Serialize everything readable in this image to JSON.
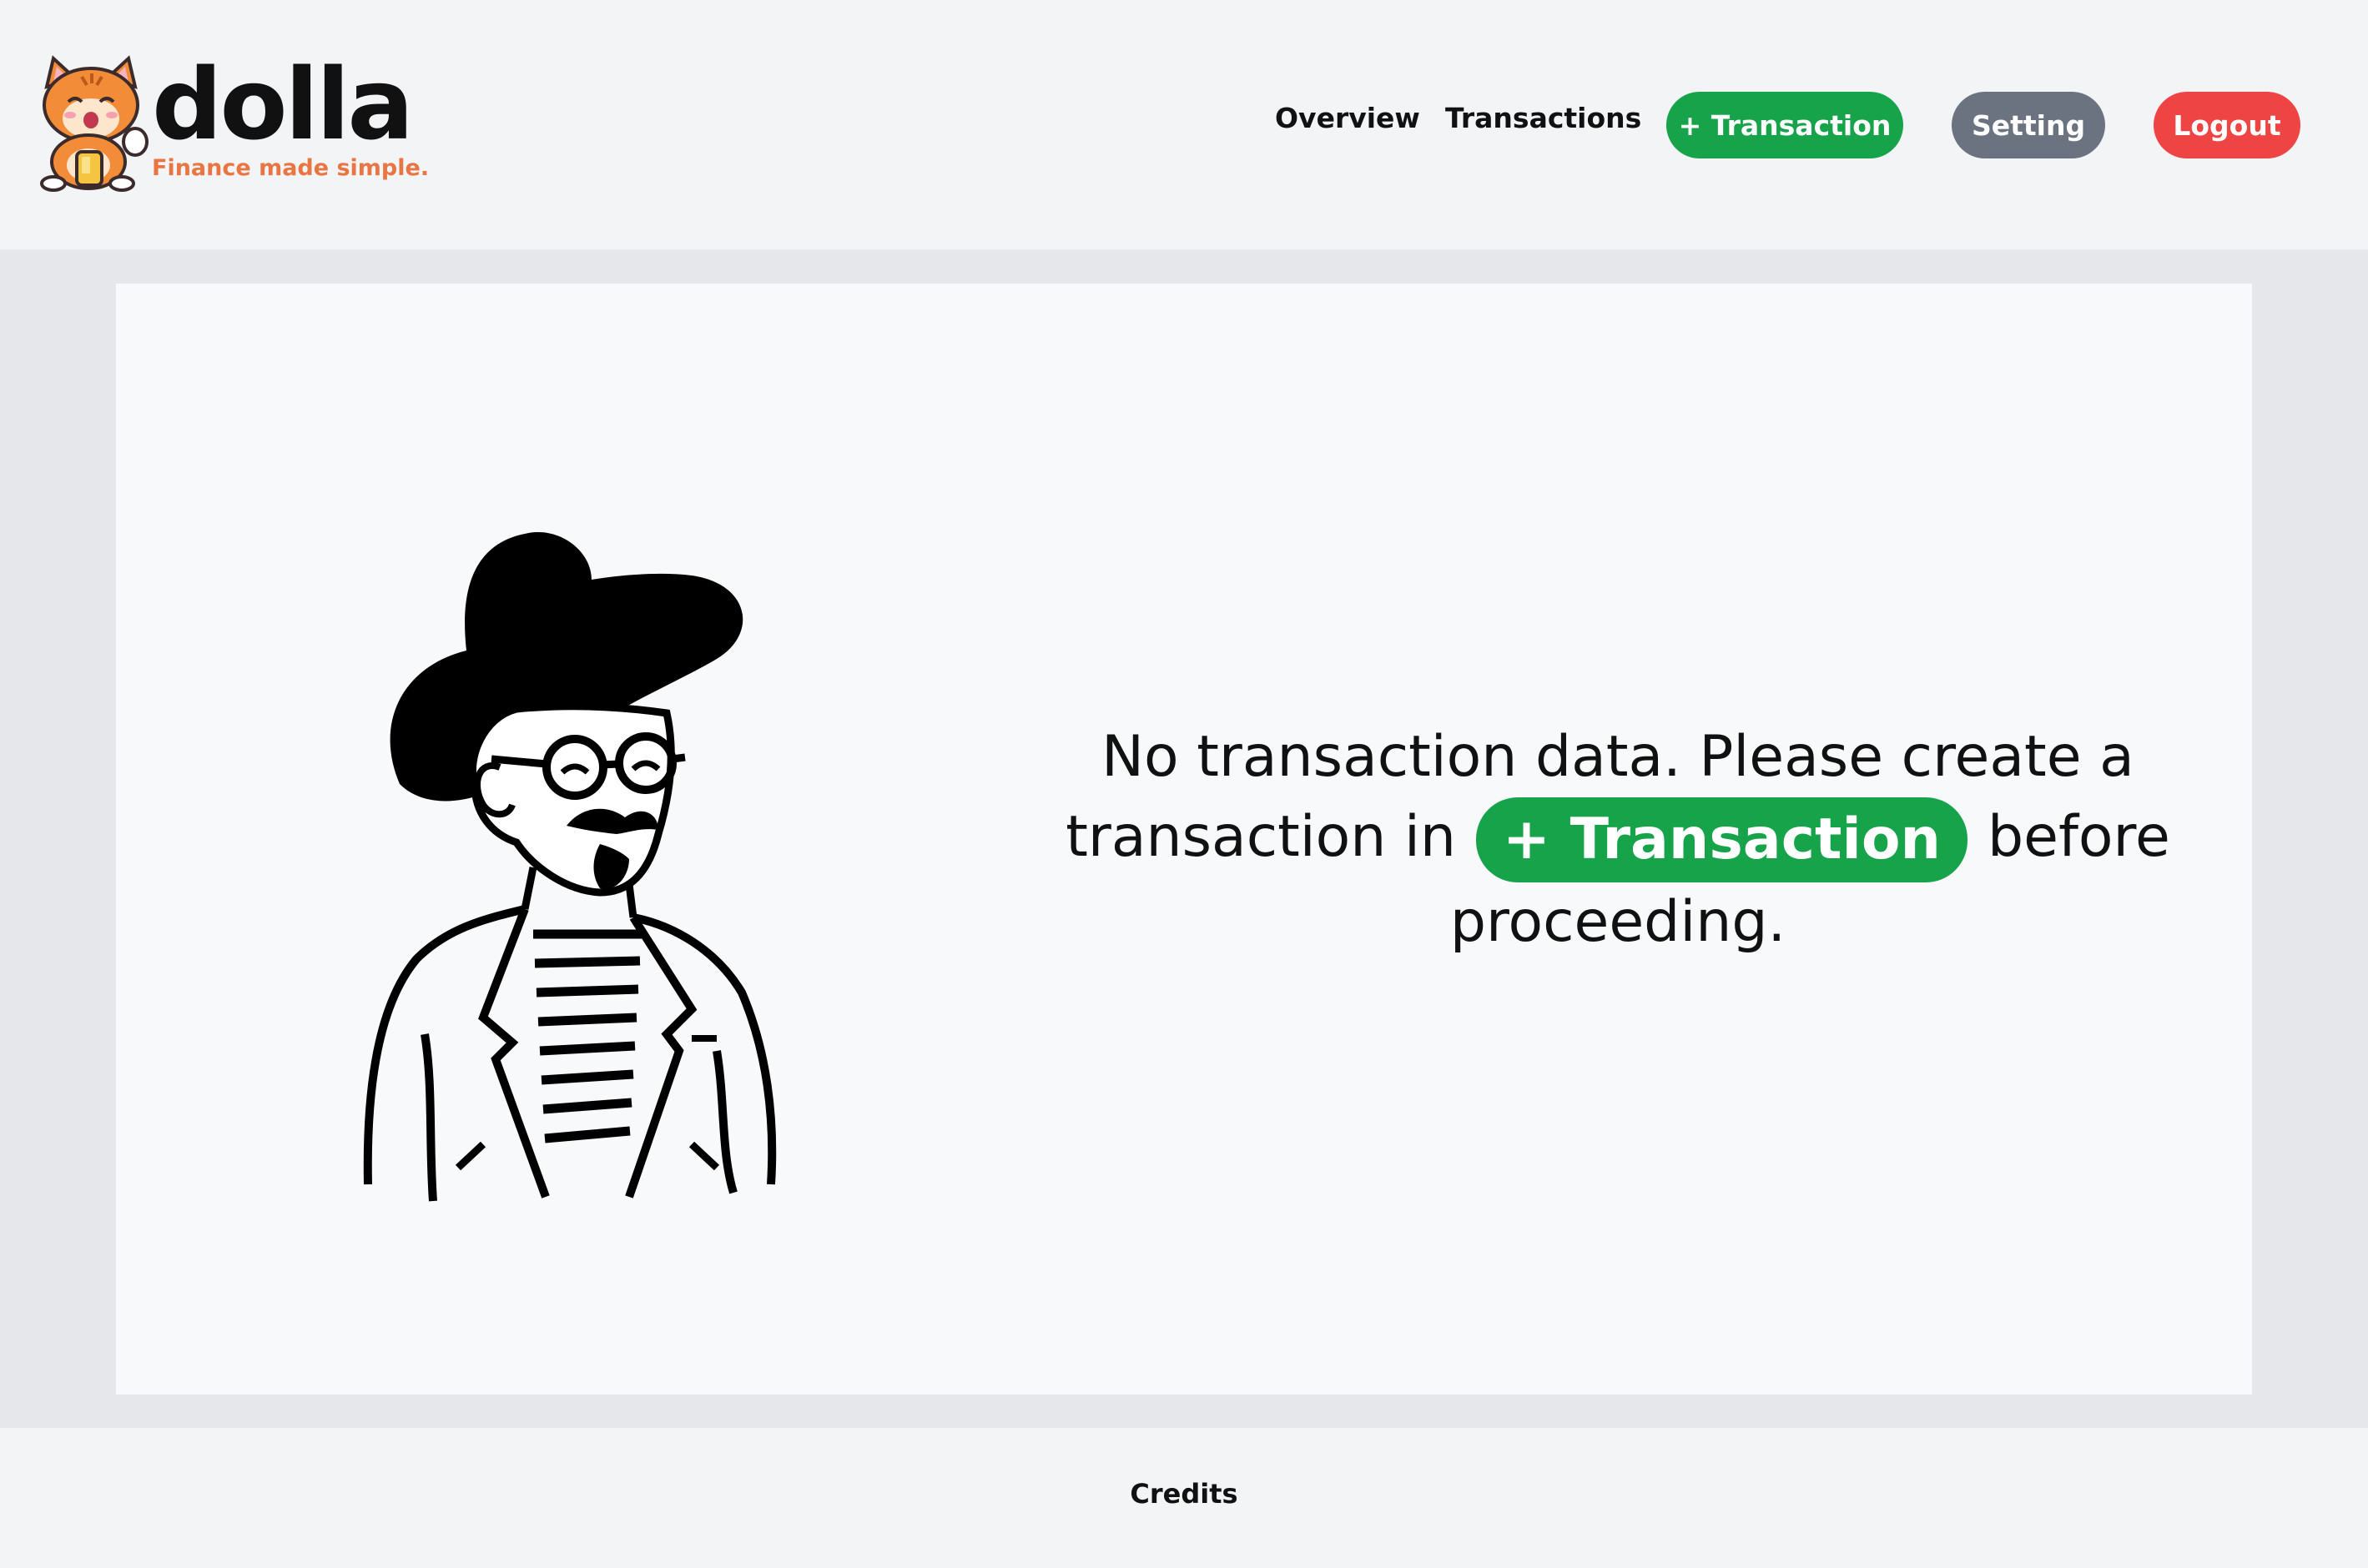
{
  "brand": {
    "name": "dolla",
    "tagline": "Finance made simple."
  },
  "nav": {
    "overview": "Overview",
    "transactions": "Transactions",
    "add_transaction": "+ Transaction",
    "setting": "Setting",
    "logout": "Logout"
  },
  "main": {
    "message_part1": "No transaction data. Please create a transaction in",
    "inline_button": "+ Transaction",
    "message_part2": "before proceeding."
  },
  "footer": {
    "credits": "Credits"
  },
  "colors": {
    "green": "#16a34a",
    "gray": "#6b7280",
    "red": "#ef4444",
    "tagline": "#e97542"
  },
  "icons": {
    "logo": "cat-mascot-icon",
    "illustration": "man-with-hat-illustration"
  }
}
